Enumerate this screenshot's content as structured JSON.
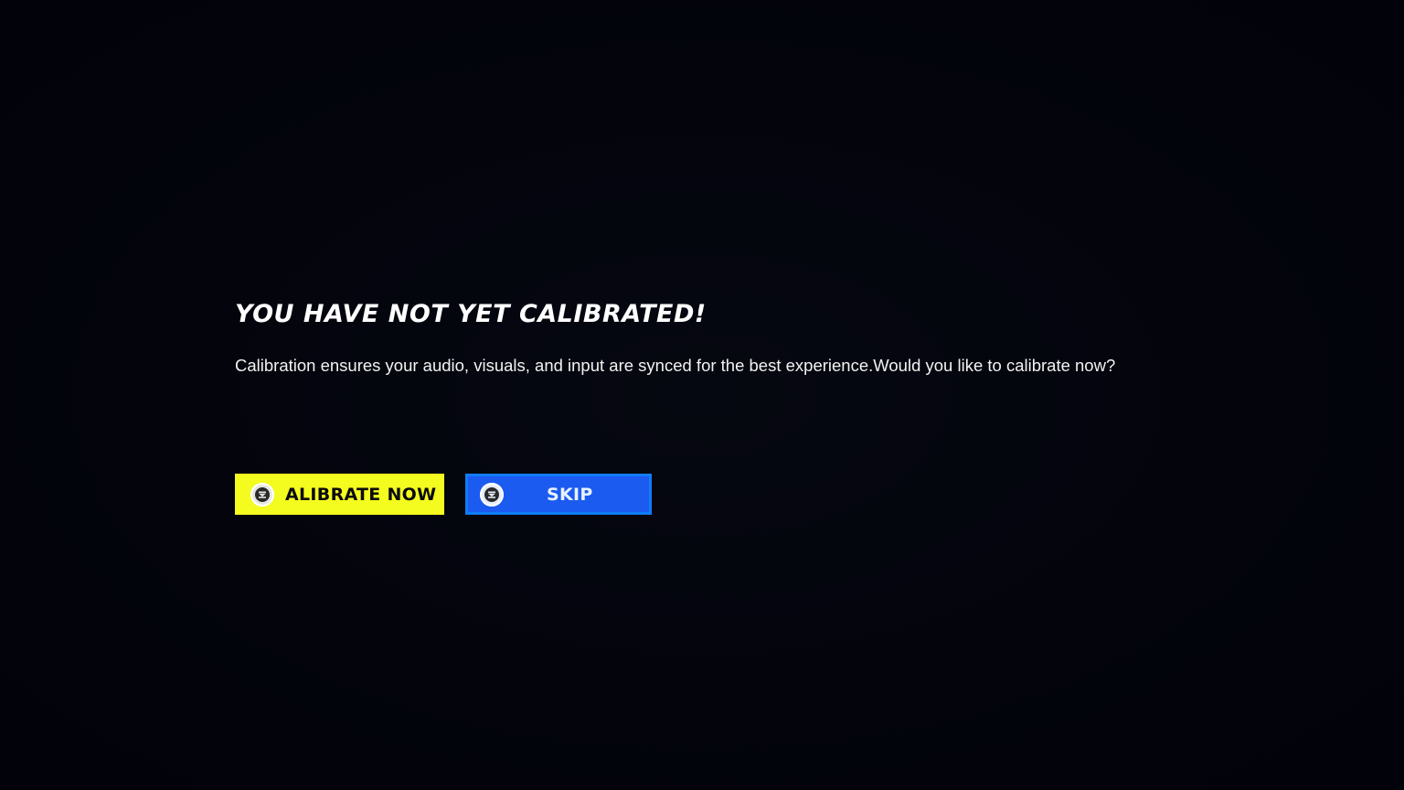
{
  "dialog": {
    "title": "YOU HAVE NOT YET CALIBRATED!",
    "message": "Calibration ensures your audio, visuals, and input are synced for the best experience.Would you like to calibrate now?"
  },
  "buttons": {
    "calibrate": {
      "label": "ALIBRATE NOW",
      "icon": "controller-button-icon",
      "color": "#f4fb1f"
    },
    "skip": {
      "label": "SKIP",
      "icon": "controller-button-icon",
      "color": "#1b5bf0"
    }
  },
  "theme": {
    "background": "#02030b",
    "text": "#ffffff"
  }
}
